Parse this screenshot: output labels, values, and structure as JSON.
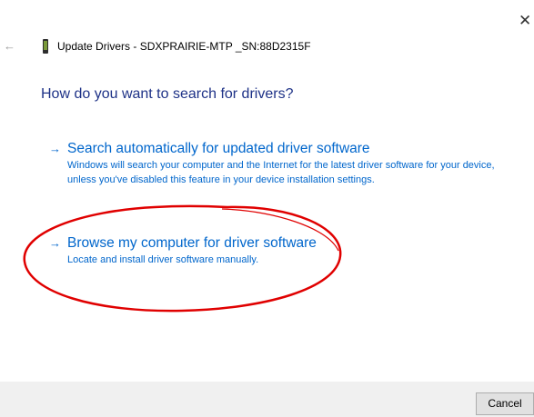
{
  "window": {
    "title": "Update Drivers - SDXPRAIRIE-MTP _SN:88D2315F",
    "close_glyph": "✕",
    "back_glyph": "←",
    "device_icon": "phone-device-icon"
  },
  "main": {
    "heading": "How do you want to search for drivers?",
    "options": [
      {
        "arrow": "→",
        "title": "Search automatically for updated driver software",
        "description": "Windows will search your computer and the Internet for the latest driver software for your device, unless you've disabled this feature in your device installation settings."
      },
      {
        "arrow": "→",
        "title": "Browse my computer for driver software",
        "description": "Locate and install driver software manually."
      }
    ]
  },
  "footer": {
    "cancel_label": "Cancel"
  },
  "colors": {
    "heading": "#1e3287",
    "link": "#0066cc",
    "annotation_ellipse": "#e00000",
    "footer_bg": "#f0f0f0"
  }
}
